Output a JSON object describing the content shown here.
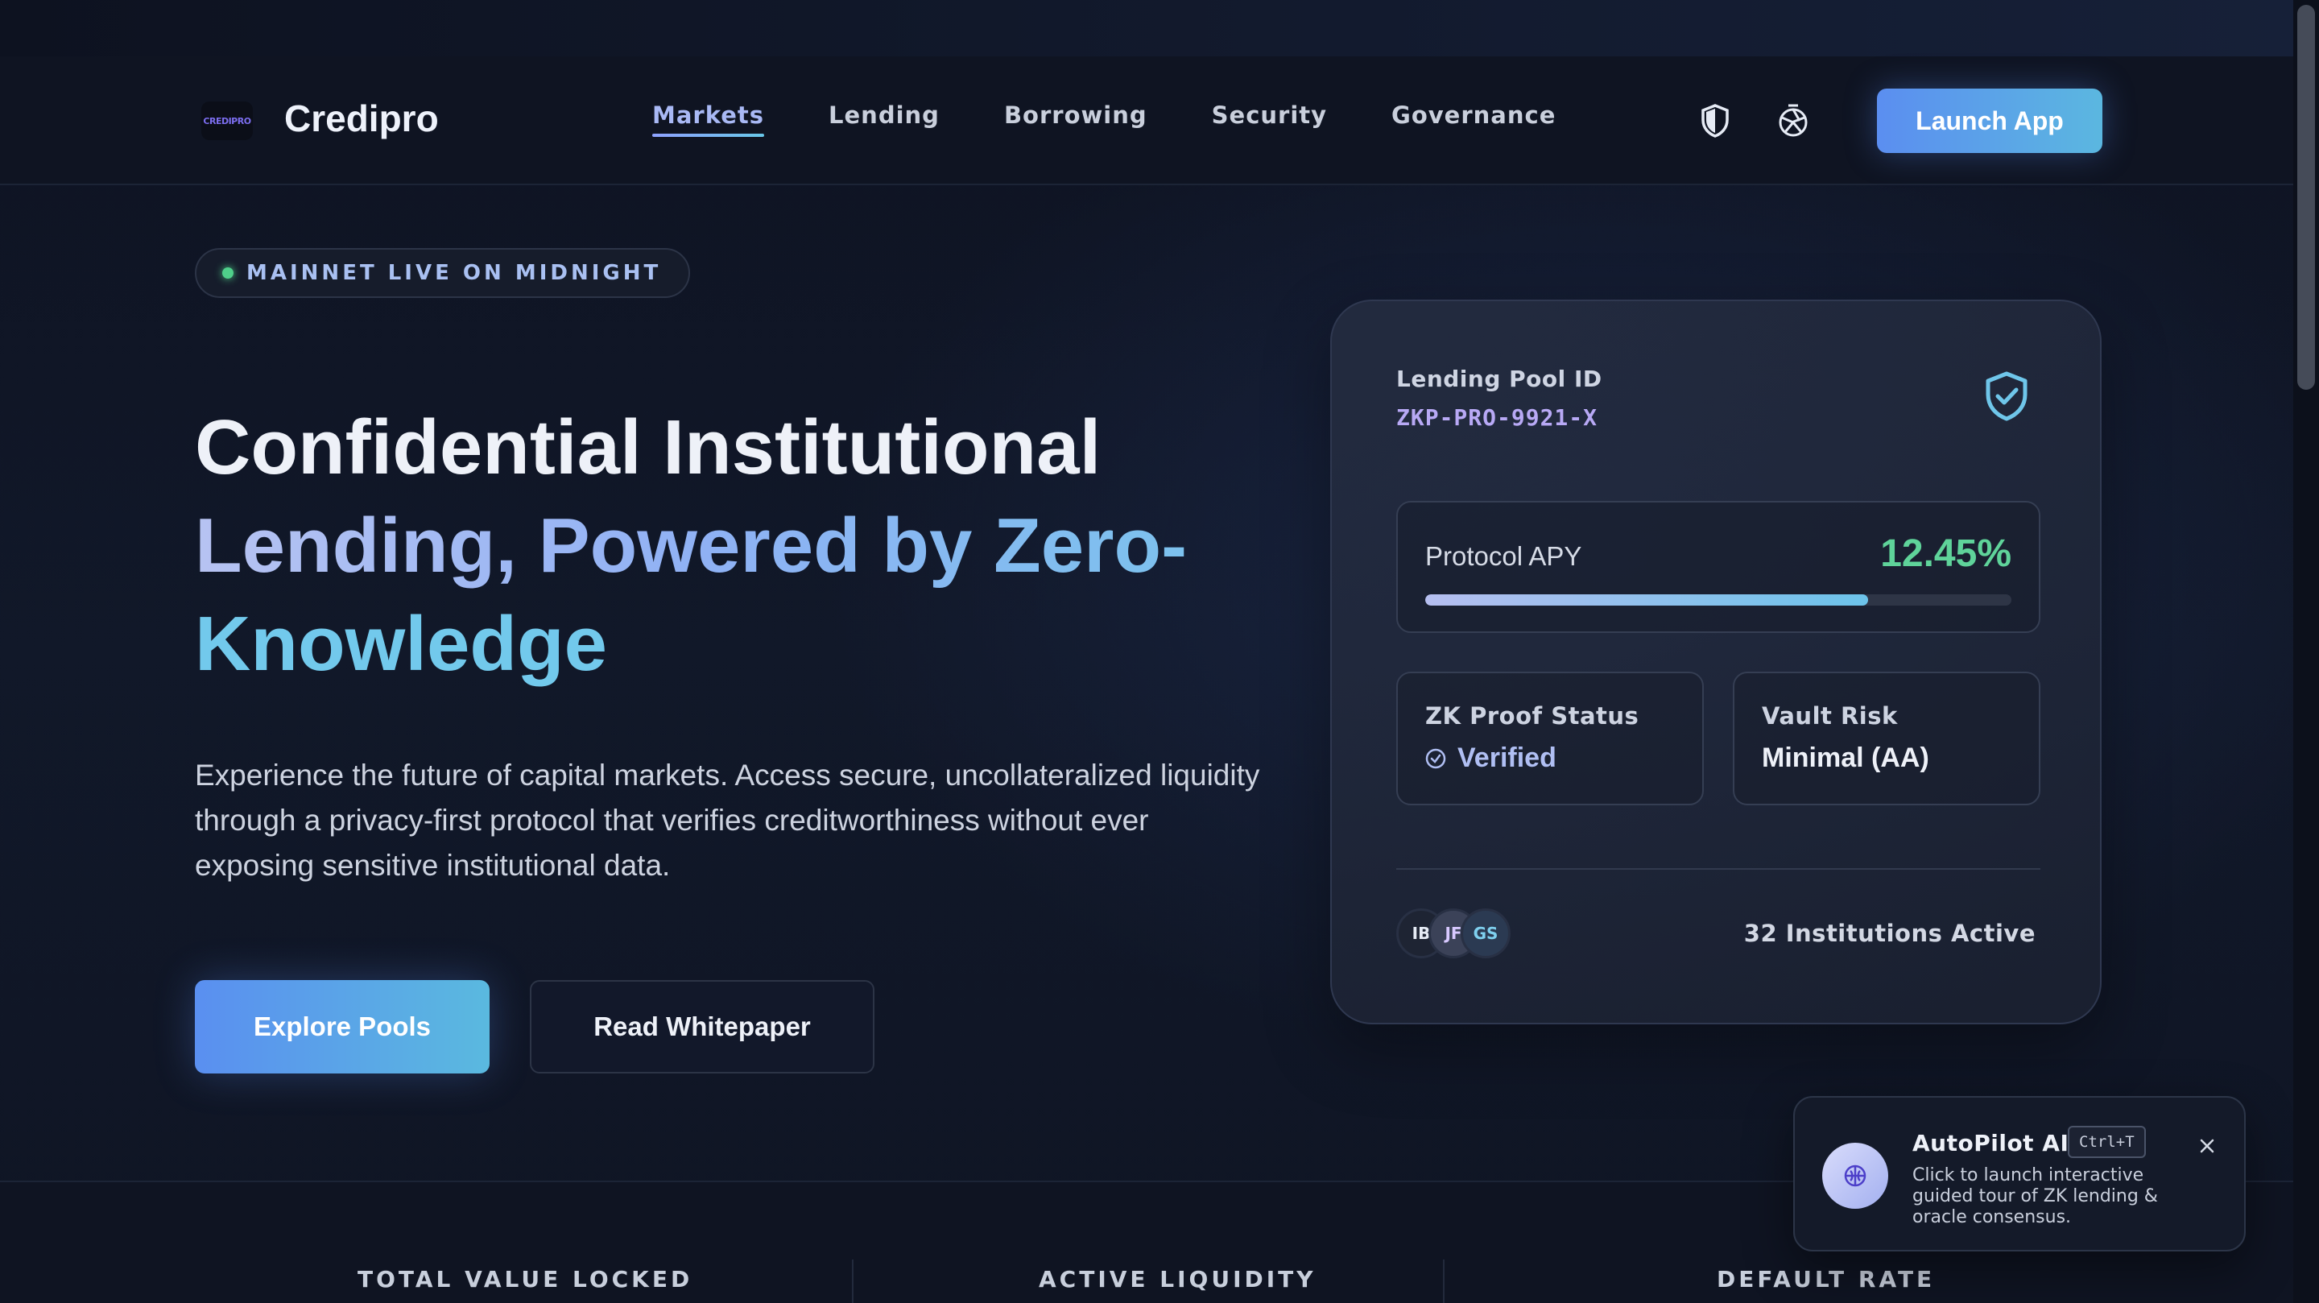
{
  "header": {
    "logo_text": "CREDIPRO",
    "brand": "Credipro",
    "nav": [
      {
        "label": "Markets",
        "active": true
      },
      {
        "label": "Lending",
        "active": false
      },
      {
        "label": "Borrowing",
        "active": false
      },
      {
        "label": "Security",
        "active": false
      },
      {
        "label": "Governance",
        "active": false
      }
    ],
    "icons": [
      "shield-icon",
      "aperture-icon"
    ],
    "launch_label": "Launch App"
  },
  "badge": {
    "text": "MAINNET LIVE ON MIDNIGHT",
    "dot_color": "#4fd08a"
  },
  "hero": {
    "line1": "Confidential Institutional",
    "line2": "Lending, Powered by Zero-",
    "line3": "Knowledge",
    "description": "Experience the future of capital markets. Access secure, uncollateralized liquidity through a privacy-first protocol that verifies creditworthiness without ever exposing sensitive institutional data.",
    "primary_button": "Explore Pools",
    "secondary_button": "Read Whitepaper"
  },
  "pool_card": {
    "label": "Lending Pool ID",
    "id": "ZKP-PRO-9921-X",
    "apy_label": "Protocol APY",
    "apy_value": "12.45%",
    "apy_progress": 0.755,
    "zk_label": "ZK Proof Status",
    "zk_value": "Verified",
    "risk_label": "Vault Risk",
    "risk_value": "Minimal (AA)",
    "avatars": [
      "IB",
      "JF",
      "GS"
    ],
    "institutions": "32 Institutions Active"
  },
  "stats": {
    "labels": [
      "TOTAL VALUE LOCKED",
      "ACTIVE LIQUIDITY",
      "DEFAULT RATE"
    ]
  },
  "toast": {
    "title": "AutoPilot AI",
    "shortcut": "Ctrl+T",
    "body": "Click to launch interactive guided tour of ZK lending & oracle consensus.",
    "icon": "brain-icon"
  },
  "colors": {
    "accent_blue": "#5b8ef0",
    "accent_cyan": "#5bb7e0",
    "success": "#5fd39a",
    "mono_purple": "#b8a9f5"
  }
}
